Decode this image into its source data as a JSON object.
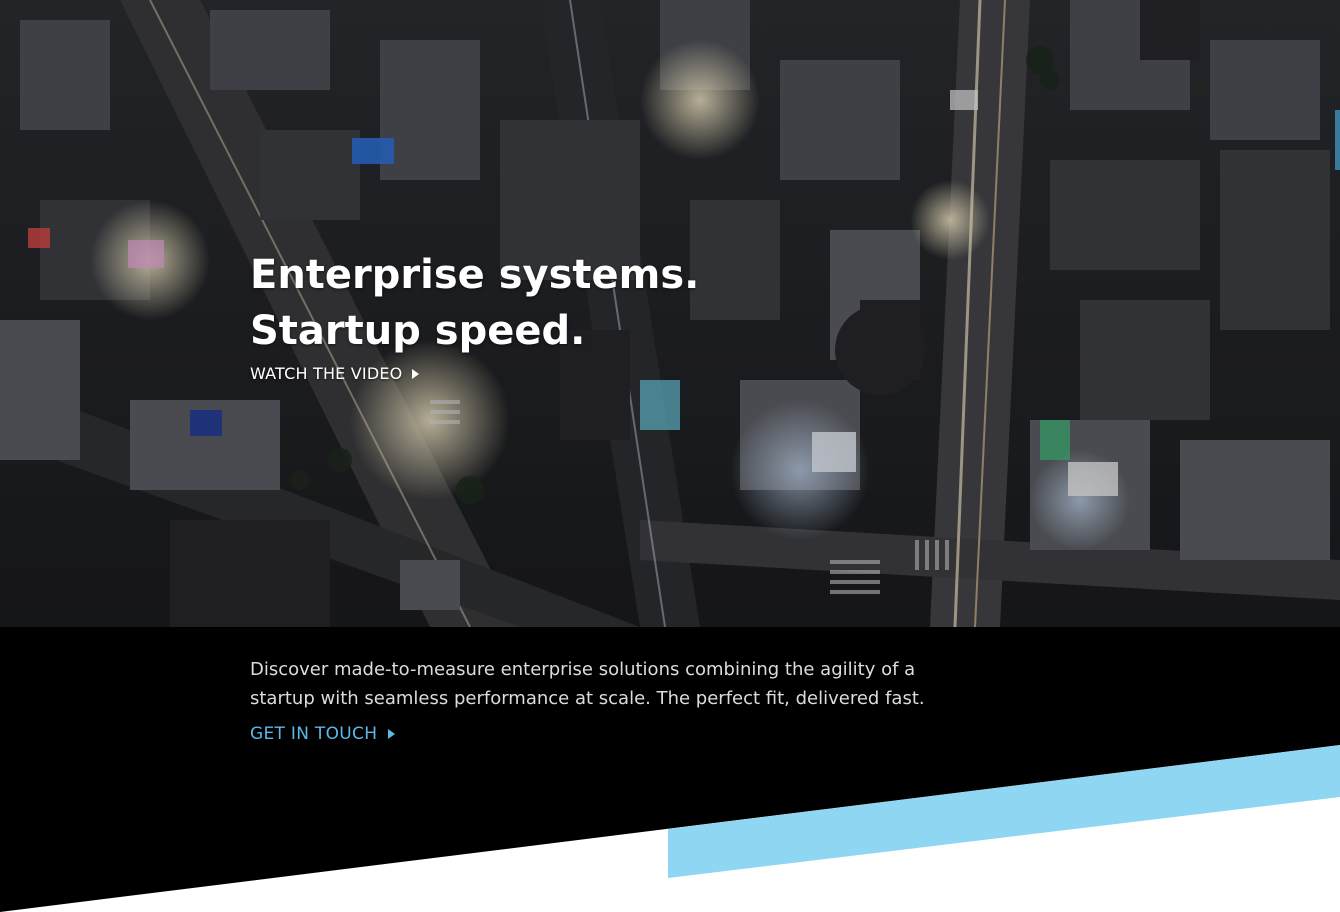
{
  "hero": {
    "title_line_1": "Enterprise systems.",
    "title_line_2": "Startup speed.",
    "watch_video_label": "WATCH THE VIDEO",
    "background_image": "aerial-city-night-photo",
    "play_icon": "play-triangle-icon"
  },
  "intro": {
    "text": "Discover made-to-measure enterprise solutions combining the agility of a startup with seamless performance at scale. The perfect fit, delivered fast.",
    "cta_label": "GET IN TOUCH",
    "cta_icon": "arrow-right-triangle-icon"
  },
  "colors": {
    "band_background": "#000000",
    "accent_stripe": "#8fd6f2",
    "cta_text": "#5bb8e8",
    "page_background": "#ffffff"
  }
}
